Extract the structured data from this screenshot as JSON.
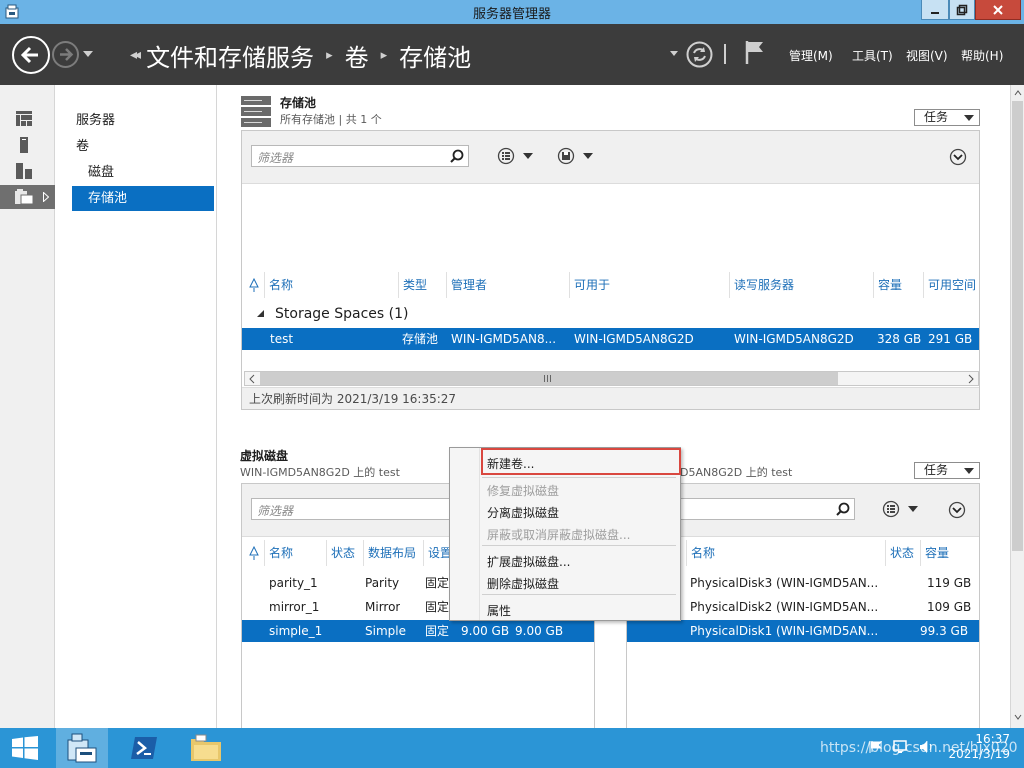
{
  "window": {
    "title": "服务器管理器"
  },
  "nav": {
    "breadcrumb": [
      "文件和存储服务",
      "卷",
      "存储池"
    ],
    "menus": [
      "管理(M)",
      "工具(T)",
      "视图(V)",
      "帮助(H)"
    ]
  },
  "tree": {
    "items": [
      "服务器",
      "卷",
      "磁盘",
      "存储池"
    ]
  },
  "pools": {
    "title": "存储池",
    "subtitle": "所有存储池 | 共 1 个",
    "tasks_label": "任务",
    "filter_placeholder": "筛选器",
    "columns": [
      "名称",
      "类型",
      "管理者",
      "可用于",
      "读写服务器",
      "容量",
      "可用空间"
    ],
    "group": "Storage Spaces (1)",
    "row": {
      "name": "test",
      "type": "存储池",
      "manager": "WIN-IGMD5AN8...",
      "available_to": "WIN-IGMD5AN8G2D",
      "rw_server": "WIN-IGMD5AN8G2D",
      "capacity": "328 GB",
      "free": "291 GB"
    },
    "refresh": "上次刷新时间为 2021/3/19 16:35:27"
  },
  "vdisks": {
    "title": "虚拟磁盘",
    "subtitle": "WIN-IGMD5AN8G2D 上的 test",
    "filter_placeholder": "筛选器",
    "columns": [
      "名称",
      "状态",
      "数据布局",
      "设置"
    ],
    "rows": [
      {
        "name": "parity_1",
        "layout": "Parity",
        "setting": "固定",
        "size1": "",
        "size2": ""
      },
      {
        "name": "mirror_1",
        "layout": "Mirror",
        "setting": "固定",
        "size1": "",
        "size2": ""
      },
      {
        "name": "simple_1",
        "layout": "Simple",
        "setting": "固定",
        "size1": "9.00 GB",
        "size2": "9.00 GB"
      }
    ]
  },
  "pdisks": {
    "subtitle": "D5AN8G2D 上的 test",
    "tasks_label": "任务",
    "columns": [
      "名称",
      "状态",
      "容量"
    ],
    "rows": [
      {
        "name": "PhysicalDisk3 (WIN-IGMD5AN...",
        "capacity": "119 GB"
      },
      {
        "name": "PhysicalDisk2 (WIN-IGMD5AN...",
        "capacity": "109 GB"
      },
      {
        "name": "PhysicalDisk1 (WIN-IGMD5AN...",
        "capacity": "99.3 GB"
      }
    ]
  },
  "context_menu": {
    "items": [
      "新建卷...",
      "修复虚拟磁盘",
      "分离虚拟磁盘",
      "屏蔽或取消屏蔽虚拟磁盘...",
      "扩展虚拟磁盘...",
      "删除虚拟磁盘",
      "属性"
    ]
  },
  "taskbar": {
    "time": "16:37",
    "date": "2021/3/19"
  },
  "watermark": "https://blog.csdn.net/hjx020",
  "colors": {
    "selection": "#0a6fc2",
    "header": "#3c3c3c",
    "titlebar": "#6bb3e6",
    "taskbar": "#2b95d6",
    "highlight": "#d9473f"
  }
}
